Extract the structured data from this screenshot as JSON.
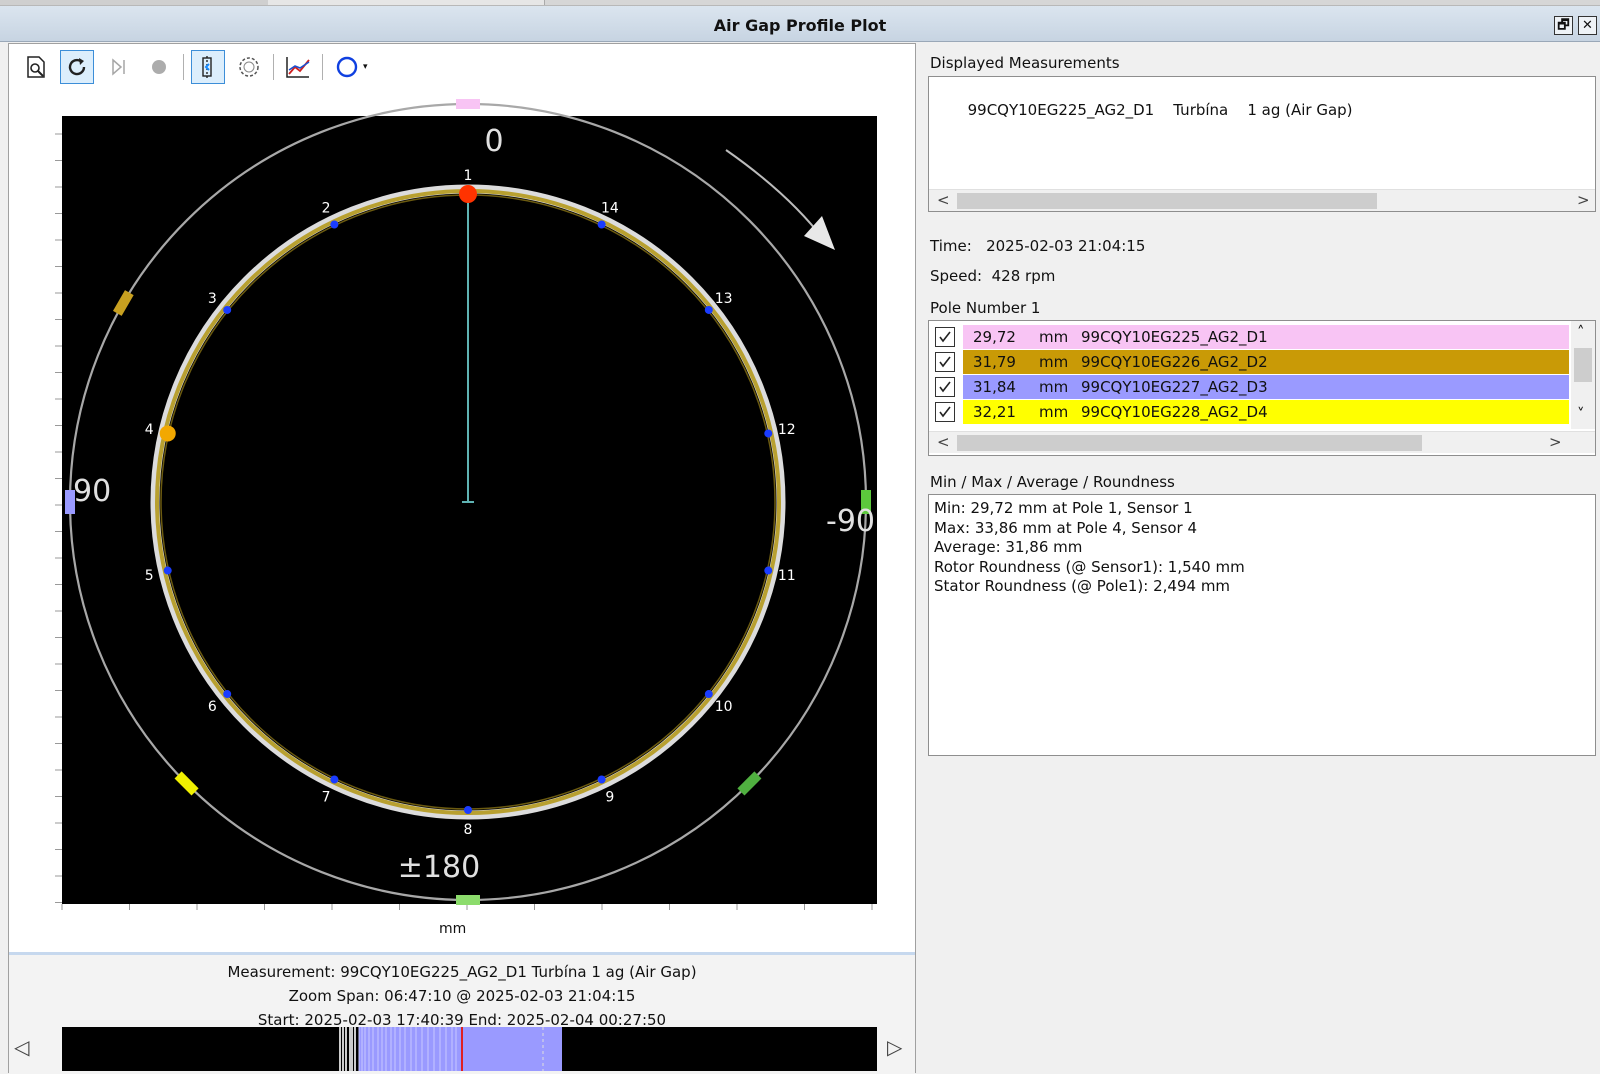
{
  "window": {
    "title": "Air Gap Profile Plot",
    "restore_glyph": "🗗",
    "close_glyph": "✕"
  },
  "toolbar": {
    "icons": [
      "zoom-page-icon",
      "refresh-icon",
      "step-forward-icon",
      "record-icon",
      "cursor-mode-icon",
      "rotor-circle-icon",
      "trend-chart-icon",
      "circle-shape-icon"
    ],
    "dropdown_glyph": "▾"
  },
  "plot": {
    "angle_labels": {
      "top": "0",
      "left": "90",
      "right": "-90",
      "bottom": "±180"
    },
    "unit_label": "mm",
    "pole_count": 14,
    "pole_labels": [
      "1",
      "2",
      "3",
      "4",
      "5",
      "6",
      "7",
      "8",
      "9",
      "10",
      "11",
      "12",
      "13",
      "14"
    ],
    "highlight_pole": 1,
    "max_pole": 4,
    "colors": {
      "background": "#000000",
      "outer_ring": "#a8a8a8",
      "rotor_profile": "#b8a030",
      "rotor_outline": "#dcdcdc",
      "pole_marker": "#1a3cff",
      "pole1_marker": "#ff3300",
      "pole4_marker": "#f2a800",
      "cursor_line": "#5fb3b3"
    },
    "sensors": [
      {
        "angle": 0,
        "color": "#f8c4f4"
      },
      {
        "angle": 90,
        "color": "#9a9aff"
      },
      {
        "angle": -90,
        "color": "#5cc93c"
      },
      {
        "angle": 180,
        "color": "#8cdc6c"
      },
      {
        "angle": 60,
        "color": "#c8a020"
      },
      {
        "angle": 135,
        "color": "#f0f000"
      },
      {
        "angle": -135,
        "color": "#50b040"
      }
    ],
    "rotation_direction": "clockwise"
  },
  "measurement_info": {
    "measurement": "Measurement: 99CQY10EG225_AG2_D1   Turbína   1 ag (Air Gap)",
    "zoom_span": "Zoom Span: 06:47:10 @ 2025-02-03 21:04:15",
    "start_end": "Start:  2025-02-03 17:40:39 End:  2025-02-04 00:27:50"
  },
  "timeline": {
    "nav_left": "◁",
    "nav_right": "▷",
    "highlight_color": "#9a9aff"
  },
  "right": {
    "displayed_measurements_label": "Displayed Measurements",
    "displayed_measurements": [
      {
        "name": "99CQY10EG225_AG2_D1",
        "machine": "Turbína",
        "type": "1 ag (Air Gap)"
      }
    ],
    "time_label": "Time:",
    "time_value": "2025-02-03 21:04:15",
    "speed_label": "Speed:",
    "speed_value": "428 rpm",
    "pole_number_label": "Pole Number 1",
    "pole_rows": [
      {
        "value": "29,72",
        "unit": "mm",
        "sensor": "99CQY10EG225_AG2_D1",
        "color": "#f8c4f4",
        "checked": true
      },
      {
        "value": "31,79",
        "unit": "mm",
        "sensor": "99CQY10EG226_AG2_D2",
        "color": "#c99a06",
        "checked": true
      },
      {
        "value": "31,84",
        "unit": "mm",
        "sensor": "99CQY10EG227_AG2_D3",
        "color": "#9a9aff",
        "checked": true
      },
      {
        "value": "32,21",
        "unit": "mm",
        "sensor": "99CQY10EG228_AG2_D4",
        "color": "#ffff00",
        "checked": true
      }
    ],
    "stats_label": "Min / Max / Average / Roundness",
    "stats": [
      "Min: 29,72 mm at Pole 1, Sensor 1",
      "Max: 33,86 mm at Pole 4, Sensor 4",
      "Average: 31,86 mm",
      "Rotor Roundness (@ Sensor1): 1,540 mm",
      "Stator Roundness (@ Pole1): 2,494 mm"
    ],
    "scroll": {
      "left": "<",
      "right": ">",
      "up": "˄",
      "down": "˅"
    }
  }
}
